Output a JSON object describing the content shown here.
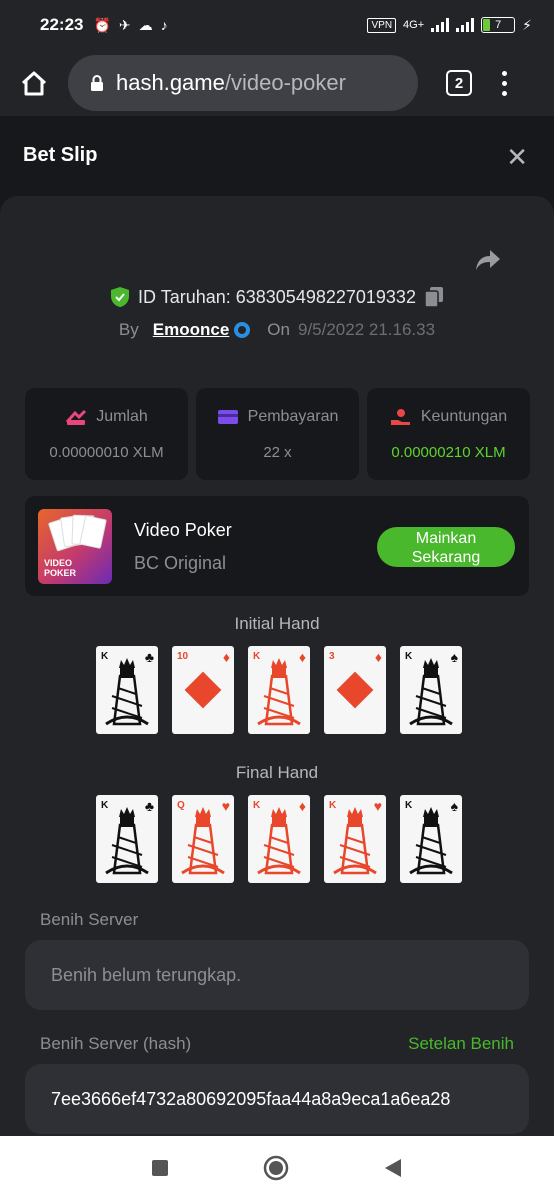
{
  "status_bar": {
    "time": "22:23",
    "vpn": "VPN",
    "network": "4G+",
    "battery": "7"
  },
  "browser": {
    "url_host": "hash.game",
    "url_path": "/video-poker",
    "tab_count": "2"
  },
  "header": {
    "title": "Bet Slip",
    "close_glyph": "✕"
  },
  "bet": {
    "id_label": "ID Taruhan: 638305498227019332",
    "by_label": "By",
    "username": "Emoonce",
    "on_label": "On",
    "date": "9/5/2022 21.16.33"
  },
  "stats": [
    {
      "label": "Jumlah",
      "value": "0.00000010 XLM",
      "icon": "amount-icon",
      "icon_color": "#e8477a"
    },
    {
      "label": "Pembayaran",
      "value": "22 x",
      "icon": "payout-card-icon",
      "icon_color": "#7b4de8"
    },
    {
      "label": "Keuntungan",
      "value": "0.00000210 XLM",
      "icon": "profit-hand-icon",
      "icon_color": "#e84747",
      "value_color": "#5dd42e"
    }
  ],
  "game": {
    "name": "Video Poker",
    "provider": "BC Original",
    "thumb_text_1": "VIDEO",
    "thumb_text_2": "POKER",
    "play_line1": "Mainkan",
    "play_line2": "Sekarang"
  },
  "initial_hand": {
    "title": "Initial Hand",
    "cards": [
      {
        "rank": "K",
        "suit": "♣",
        "color": "#111111",
        "face": true
      },
      {
        "rank": "10",
        "suit": "♦",
        "color": "#e8472b",
        "face": false
      },
      {
        "rank": "K",
        "suit": "♦",
        "color": "#e8472b",
        "face": true
      },
      {
        "rank": "3",
        "suit": "♦",
        "color": "#e8472b",
        "face": false
      },
      {
        "rank": "K",
        "suit": "♠",
        "color": "#111111",
        "face": true
      }
    ]
  },
  "final_hand": {
    "title": "Final Hand",
    "cards": [
      {
        "rank": "K",
        "suit": "♣",
        "color": "#111111",
        "face": true
      },
      {
        "rank": "Q",
        "suit": "♥",
        "color": "#e8472b",
        "face": true
      },
      {
        "rank": "K",
        "suit": "♦",
        "color": "#e8472b",
        "face": true
      },
      {
        "rank": "K",
        "suit": "♥",
        "color": "#e8472b",
        "face": true
      },
      {
        "rank": "K",
        "suit": "♠",
        "color": "#111111",
        "face": true
      }
    ]
  },
  "seeds": {
    "server_label": "Benih Server",
    "server_value": "Benih belum terungkap.",
    "hash_label": "Benih Server (hash)",
    "settings_link": "Setelan Benih",
    "hash_value": "7ee3666ef4732a80692095faa44a8a9eca1a6ea28"
  },
  "colors": {
    "background": "#17181b",
    "panel": "#232428",
    "accent_green": "#4ab82c"
  }
}
